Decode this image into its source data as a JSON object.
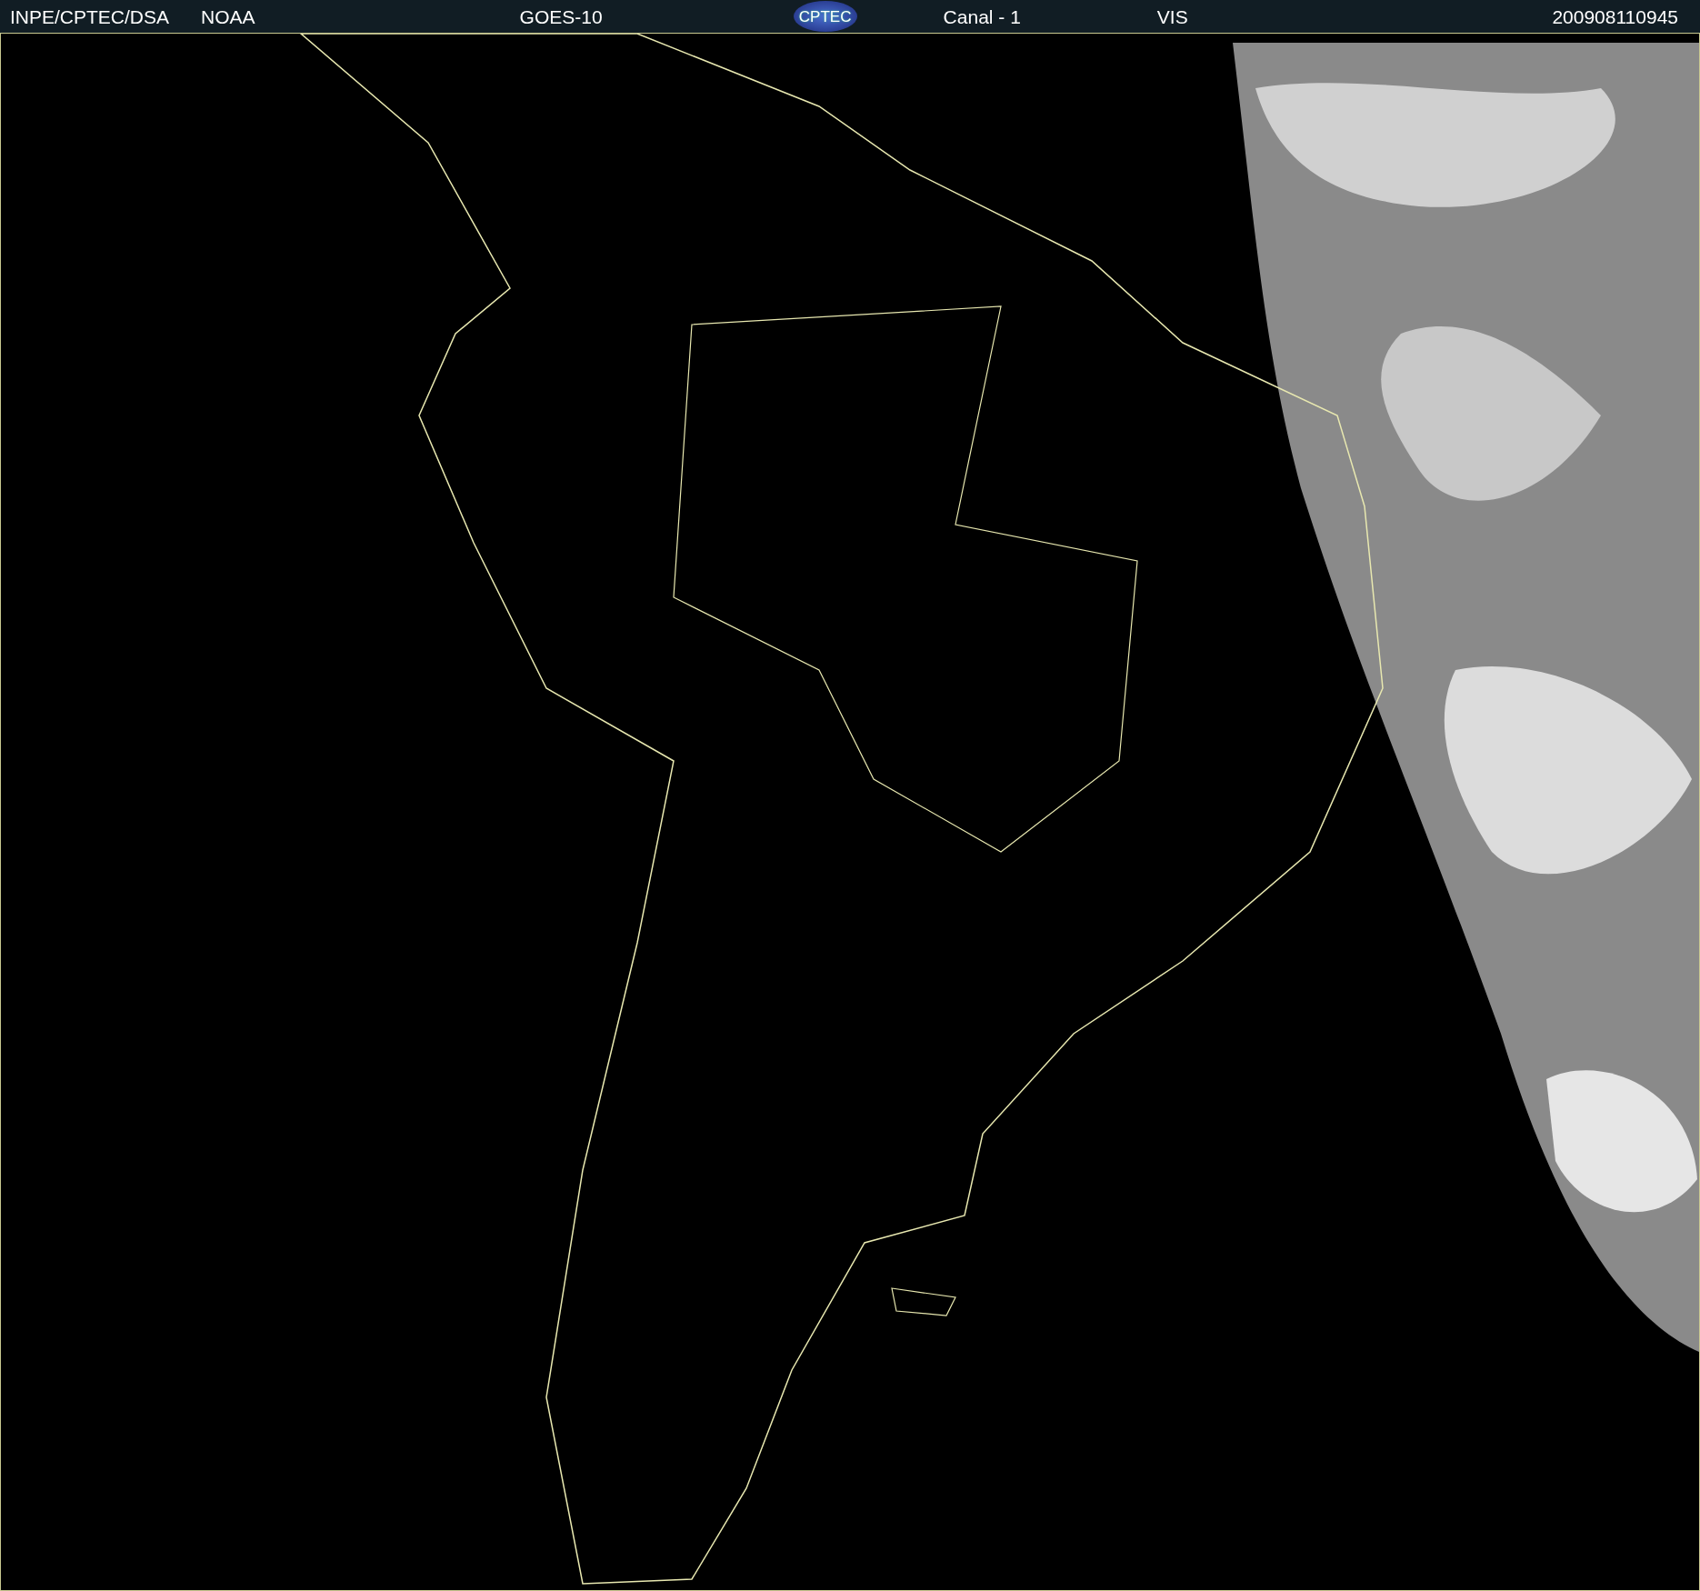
{
  "header": {
    "source": "INPE/CPTEC/DSA",
    "agency": "NOAA",
    "satellite": "GOES-10",
    "logo": "CPTEC",
    "channel": "Canal - 1",
    "band": "VIS",
    "timestamp": "200908110945"
  }
}
